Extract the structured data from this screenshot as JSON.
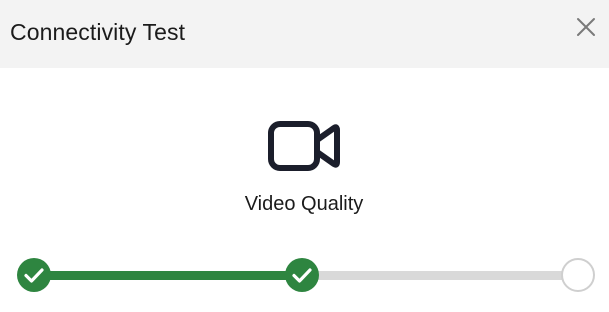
{
  "dialog": {
    "title": "Connectivity Test",
    "close_icon": "close-icon"
  },
  "current_step": {
    "icon": "video-camera-icon",
    "label": "Video Quality"
  },
  "progress": {
    "steps": [
      {
        "state": "complete",
        "icon": "checkmark-icon"
      },
      {
        "state": "complete",
        "icon": "checkmark-icon"
      },
      {
        "state": "pending"
      }
    ],
    "completed_fraction": 0.5
  },
  "colors": {
    "header_bg": "#f3f3f3",
    "accent_green": "#2e8540",
    "track_gray": "#d9d9d9",
    "text": "#1b1b1b",
    "icon": "#1b1e2b"
  }
}
